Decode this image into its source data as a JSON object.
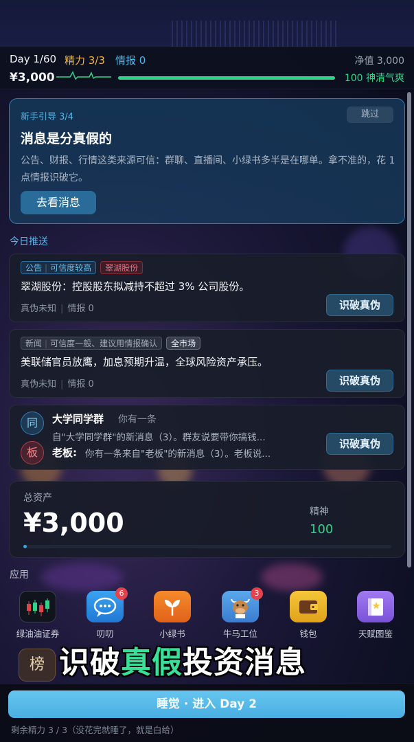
{
  "status": {
    "day": "Day 1/60",
    "energy": "精力 3/3",
    "intel": "情报 0",
    "net_worth": "净值 3,000",
    "money": "¥3,000",
    "mood": "100 神清气爽",
    "mood_level": 1.0,
    "colors": {
      "energy": "#f2b740",
      "intel": "#4fb6e8",
      "mood": "#2fd489"
    }
  },
  "tutorial": {
    "step": "新手引导 3/4",
    "skip": "跳过",
    "title": "消息是分真假的",
    "body": "公告、财报、行情这类来源可信：群聊、直播间、小绿书多半是在哪单。拿不准的，花 1 点情报识破它。",
    "action": "去看消息"
  },
  "feed": {
    "title": "今日推送",
    "news": [
      {
        "tag_source": "公告",
        "tag_cred": "可信度较高",
        "tag_subject": "翠湖股份",
        "text": "翠湖股份：控股股东拟减持不超过 3% 公司股份。",
        "truth": "真伪未知",
        "intel": "情报 0",
        "action": "识破真伪"
      },
      {
        "tag_source": "新闻",
        "tag_cred": "可信度一般、建议用情报确认",
        "tag_subject": "全市场",
        "text": "美联储官员放鹰，加息预期升温，全球风险资产承压。",
        "truth": "真伪未知",
        "intel": "情报 0",
        "action": "识破真伪"
      }
    ],
    "chat": {
      "group_avatar": "同",
      "group_name": "大学同学群",
      "group_sub": "你有一条",
      "group_msg": "自\"大学同学群\"的新消息（3）。群友说要带你搞钱...",
      "boss_avatar": "板",
      "boss_name": "老板:",
      "boss_msg": "你有一条来自\"老板\"的新消息（3）。老板说...",
      "action": "识破真伪"
    }
  },
  "assets": {
    "label": "总资产",
    "value": "¥3,000",
    "spirit_label": "精神",
    "spirit_value": "100",
    "progress": 0.01
  },
  "apps": {
    "title": "应用",
    "items": [
      {
        "label": "绿油油证券",
        "icon": "stock-chart-icon",
        "badge": ""
      },
      {
        "label": "叨叨",
        "icon": "chat-bubble-icon",
        "badge": "6"
      },
      {
        "label": "小绿书",
        "icon": "sprout-icon",
        "badge": ""
      },
      {
        "label": "牛马工位",
        "icon": "ox-icon",
        "badge": "3"
      },
      {
        "label": "钱包",
        "icon": "wallet-icon",
        "badge": ""
      },
      {
        "label": "天赋图鉴",
        "icon": "book-icon",
        "badge": ""
      }
    ],
    "rank": "榜"
  },
  "slogan": {
    "part1": "识破",
    "highlight": "真假",
    "part2": "投资消息"
  },
  "footer": {
    "sleep": "睡觉 · 进入 Day 2",
    "remaining": "剩余精力 3 / 3（没花完就睡了，就是白给）"
  }
}
